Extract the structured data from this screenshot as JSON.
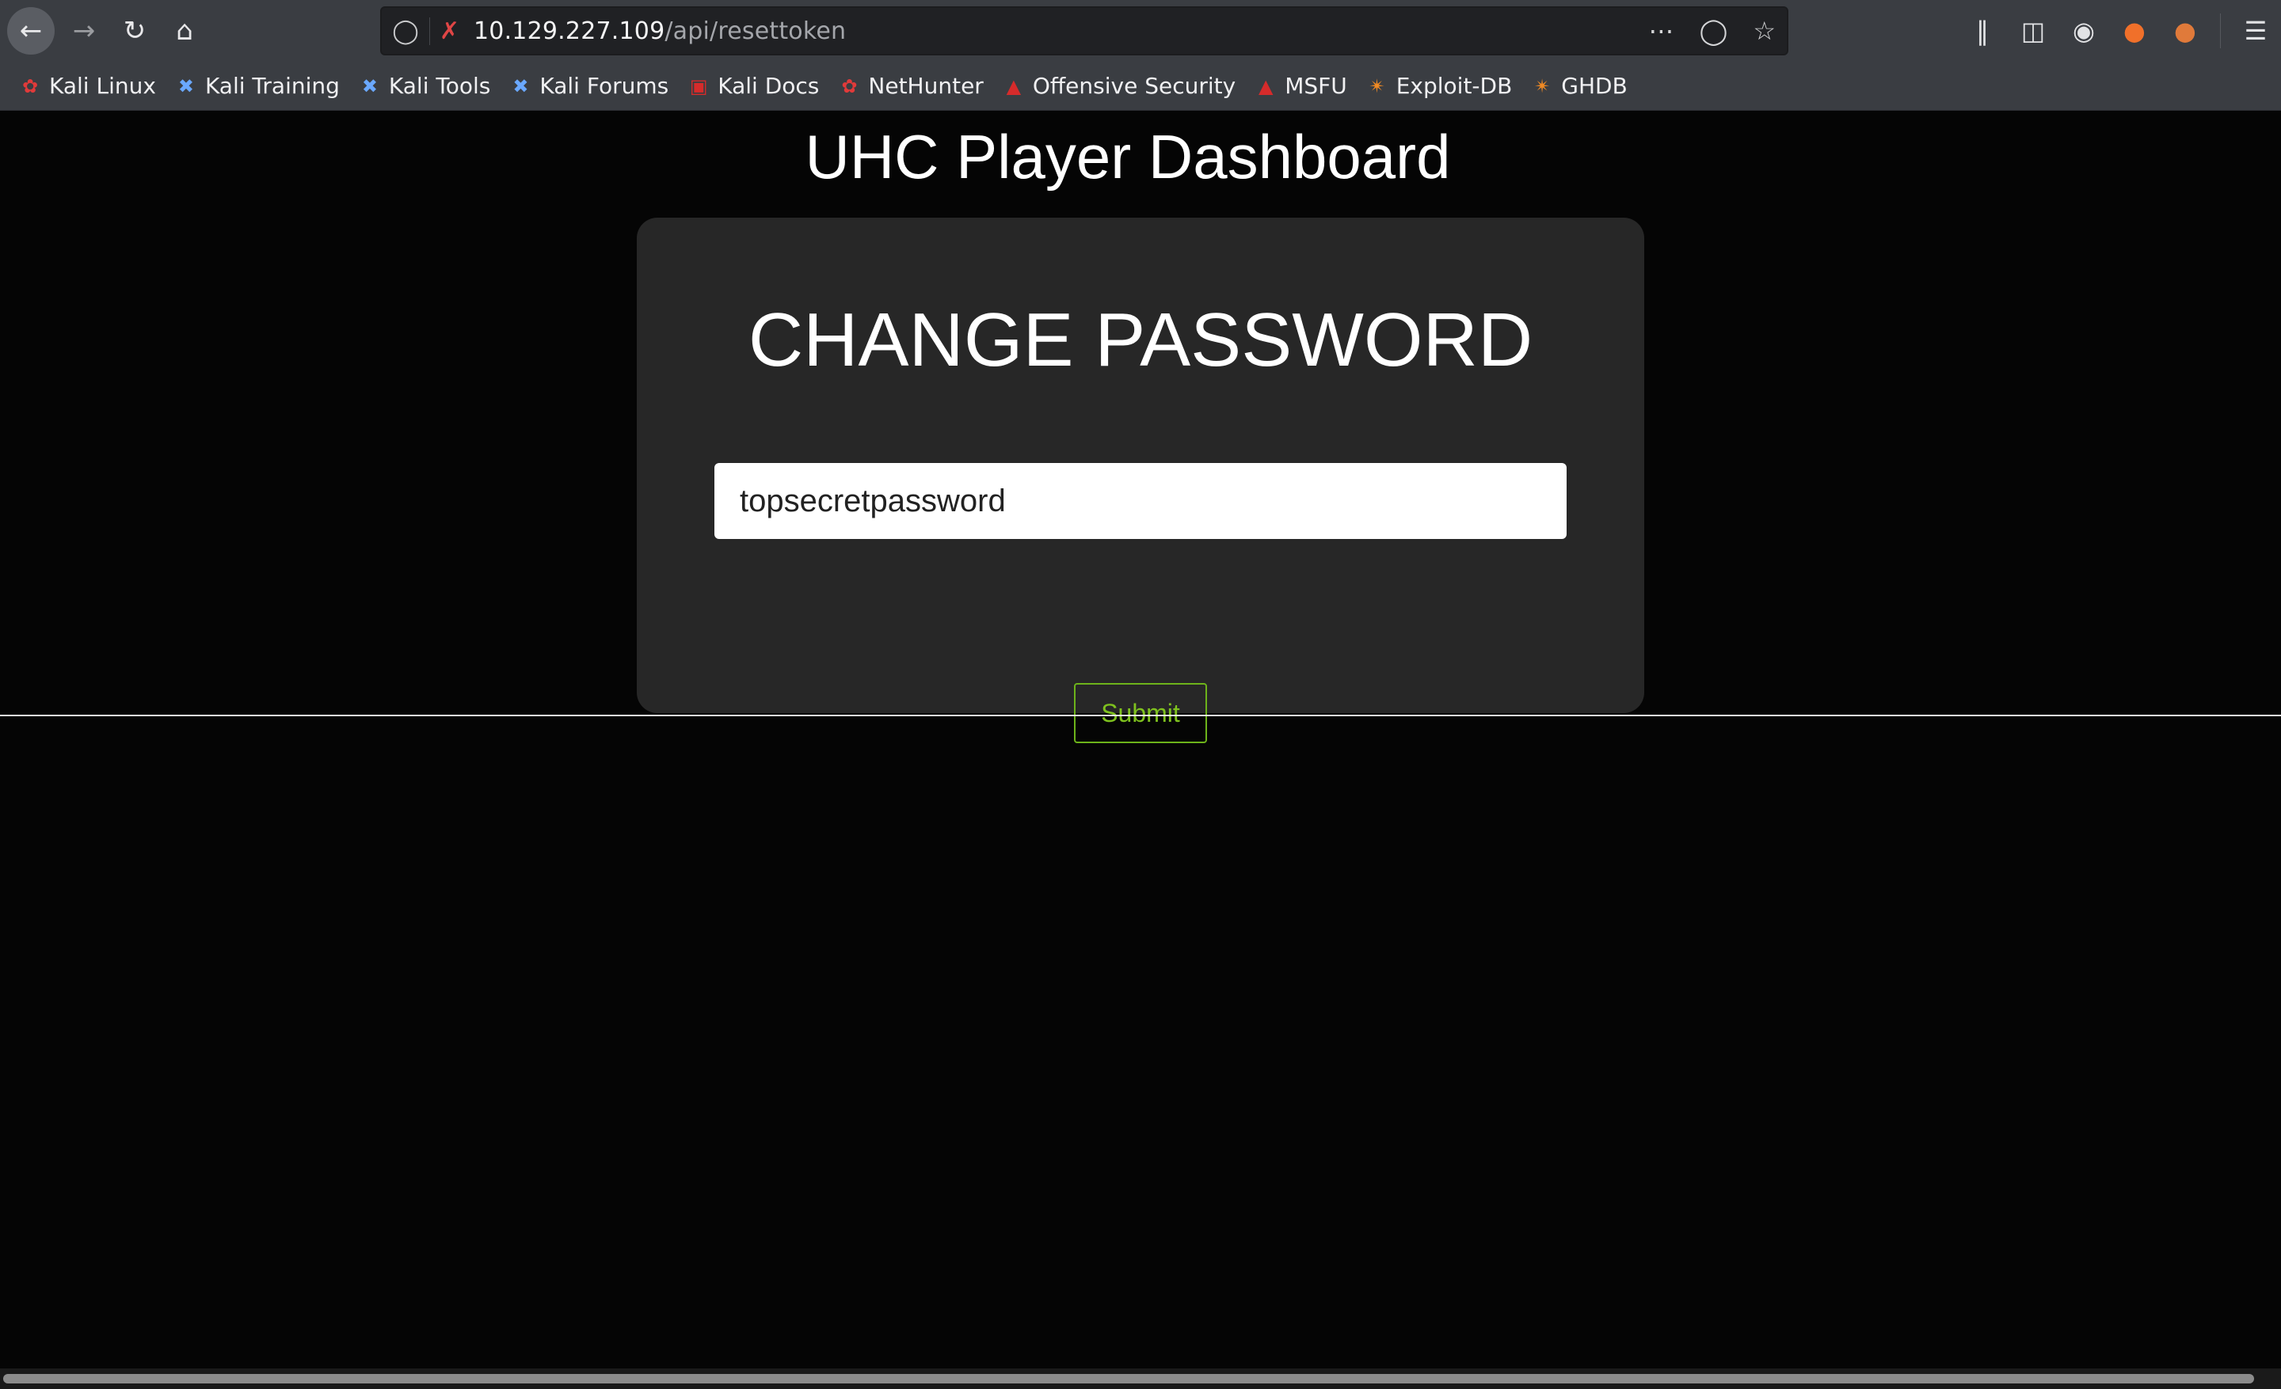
{
  "browser": {
    "url_host": "10.129.227.109",
    "url_path": "/api/resettoken",
    "icons": [
      "back-icon",
      "forward-icon",
      "reload-icon",
      "home-icon",
      "shield-icon",
      "insecure-lock-icon",
      "more-icon",
      "pocket-icon",
      "star-icon",
      "library-icon",
      "sidebar-icon",
      "account-icon",
      "extension-icon",
      "extension-icon-2",
      "menu-icon"
    ]
  },
  "bookmarks": [
    {
      "label": "Kali Linux",
      "icon": "kali-dragon-icon"
    },
    {
      "label": "Kali Training",
      "icon": "kali-tool-icon"
    },
    {
      "label": "Kali Tools",
      "icon": "kali-tool-icon"
    },
    {
      "label": "Kali Forums",
      "icon": "kali-tool-icon"
    },
    {
      "label": "Kali Docs",
      "icon": "kali-docs-icon"
    },
    {
      "label": "NetHunter",
      "icon": "kali-dragon-icon"
    },
    {
      "label": "Offensive Security",
      "icon": "offsec-icon"
    },
    {
      "label": "MSFU",
      "icon": "offsec-icon"
    },
    {
      "label": "Exploit-DB",
      "icon": "exploitdb-icon"
    },
    {
      "label": "GHDB",
      "icon": "exploitdb-icon"
    }
  ],
  "page": {
    "title": "UHC Player Dashboard",
    "card_title": "CHANGE PASSWORD",
    "password_value": "topsecretpassword",
    "submit_label": "Submit",
    "accent_color": "#7fc21e"
  }
}
